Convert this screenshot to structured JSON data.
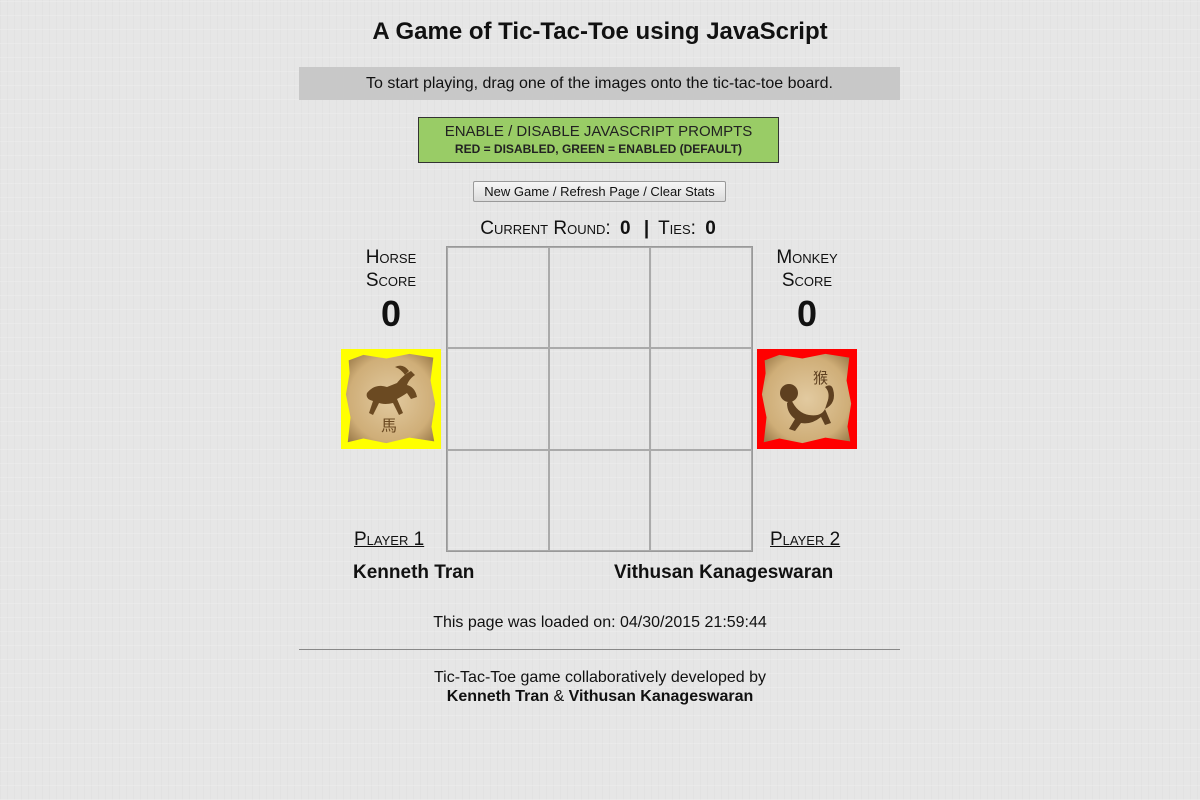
{
  "title": "A Game of Tic-Tac-Toe using JavaScript",
  "instructions": "To start playing, drag one of the images onto the tic-tac-toe board.",
  "prompt_toggle": {
    "line1": "ENABLE / DISABLE JAVASCRIPT PROMPTS",
    "line2": "RED = DISABLED, GREEN = ENABLED (DEFAULT)",
    "state_color": "#99cc66"
  },
  "new_game_button": "New Game / Refresh Page / Clear Stats",
  "round": {
    "round_label": "Current Round:",
    "round_value": "0",
    "separator": "|",
    "ties_label": "Ties:",
    "ties_value": "0"
  },
  "player1": {
    "animal_label": "Horse",
    "score_label": "Score",
    "score": "0",
    "player_label": "Player 1",
    "name": "Kenneth Tran",
    "highlight_color": "#ffff00",
    "icon": "horse-icon"
  },
  "player2": {
    "animal_label": "Monkey",
    "score_label": "Score",
    "score": "0",
    "player_label": "Player 2",
    "name": "Vithusan Kanageswaran",
    "highlight_color": "#ff0000",
    "icon": "monkey-icon"
  },
  "board": {
    "cells": [
      "",
      "",
      "",
      "",
      "",
      "",
      "",
      "",
      ""
    ]
  },
  "footer": {
    "loaded_text": "This page was loaded on: 04/30/2015 21:59:44",
    "credits_line1": "Tic-Tac-Toe game collaboratively developed by",
    "credits_name1": "Kenneth Tran",
    "credits_amp": "&",
    "credits_name2": "Vithusan Kanageswaran"
  }
}
